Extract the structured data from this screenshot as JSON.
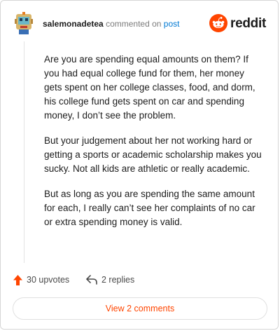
{
  "header": {
    "username": "salemonadetea",
    "action_text": "commented on",
    "target_link": "post",
    "brand": "reddit"
  },
  "comment": {
    "paragraphs": [
      "Are you are spending equal amounts on them? If you had equal college fund for them, her money gets spent on her college classes, food, and dorm, his college fund gets spent on car and spending money, I don’t see the problem.",
      "But your judgement about her not working hard or getting a sports or academic scholarship makes you sucky. Not all kids are athletic or really academic.",
      "But as long as you are spending the same amount for each, I really can’t see her complaints of no car or extra spending money is valid."
    ]
  },
  "actions": {
    "upvotes": "30 upvotes",
    "replies": "2 replies"
  },
  "footer": {
    "view_comments": "View 2 comments"
  },
  "colors": {
    "accent": "#ff4500",
    "link": "#0079d3"
  },
  "icons": [
    "avatar",
    "reddit-logo-icon",
    "upvote-arrow-icon",
    "reply-arrow-icon"
  ]
}
